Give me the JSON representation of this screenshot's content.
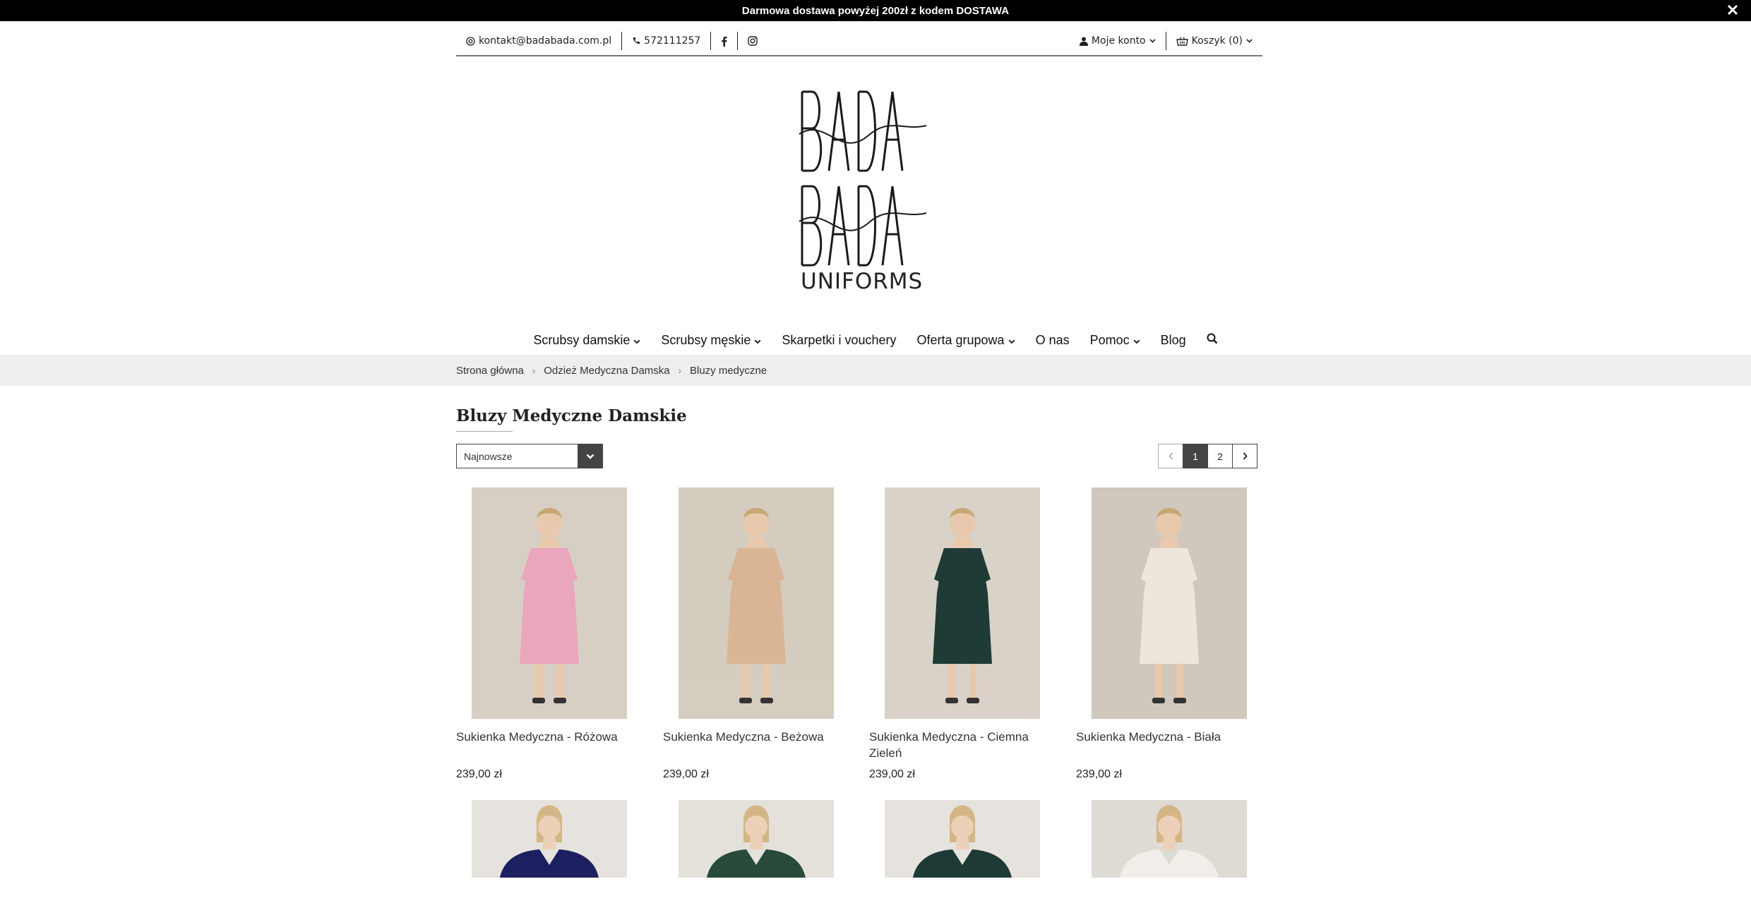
{
  "promo": {
    "text": "Darmowa dostawa powyżej 200zł z kodem DOSTAWA"
  },
  "topbar": {
    "email": "kontakt@badabada.com.pl",
    "phone": "572111257",
    "account": "Moje konto",
    "cart": "Koszyk (0)"
  },
  "logo": {
    "line1": "BADA",
    "line2": "BADA",
    "line3": "UNIFORMS"
  },
  "nav": [
    {
      "label": "Scrubsy damskie",
      "dropdown": true
    },
    {
      "label": "Scrubsy męskie",
      "dropdown": true
    },
    {
      "label": "Skarpetki i vouchery",
      "dropdown": false
    },
    {
      "label": "Oferta grupowa",
      "dropdown": true
    },
    {
      "label": "O nas",
      "dropdown": false
    },
    {
      "label": "Pomoc",
      "dropdown": true
    },
    {
      "label": "Blog",
      "dropdown": false
    }
  ],
  "breadcrumbs": [
    "Strona główna",
    "Odzież Medyczna Damska",
    "Bluzy medyczne"
  ],
  "page_title": "Bluzy Medyczne Damskie",
  "sort": {
    "selected": "Najnowsze"
  },
  "pagination": {
    "pages": [
      "1",
      "2"
    ],
    "current": "1"
  },
  "products": [
    {
      "name": "Sukienka Medyczna - Różowa",
      "price": "239,00 zł",
      "color": "#e9a6bd",
      "bg": "#d8cfc4"
    },
    {
      "name": "Sukienka Medyczna - Beżowa",
      "price": "239,00 zł",
      "color": "#d9b596",
      "bg": "#d5ccc0"
    },
    {
      "name": "Sukienka Medyczna - Ciemna Zieleń",
      "price": "239,00 zł",
      "color": "#1f3b36",
      "bg": "#d9d2c8"
    },
    {
      "name": "Sukienka Medyczna - Biała",
      "price": "239,00 zł",
      "color": "#ede6dc",
      "bg": "#d0c8bd"
    }
  ],
  "products_row2": [
    {
      "color": "#1c2060",
      "bg": "#e6e2dd"
    },
    {
      "color": "#274a3a",
      "bg": "#e4e0da"
    },
    {
      "color": "#1e3a36",
      "bg": "#e6e2dd"
    },
    {
      "color": "#f1eeea",
      "bg": "#dedad4"
    }
  ]
}
